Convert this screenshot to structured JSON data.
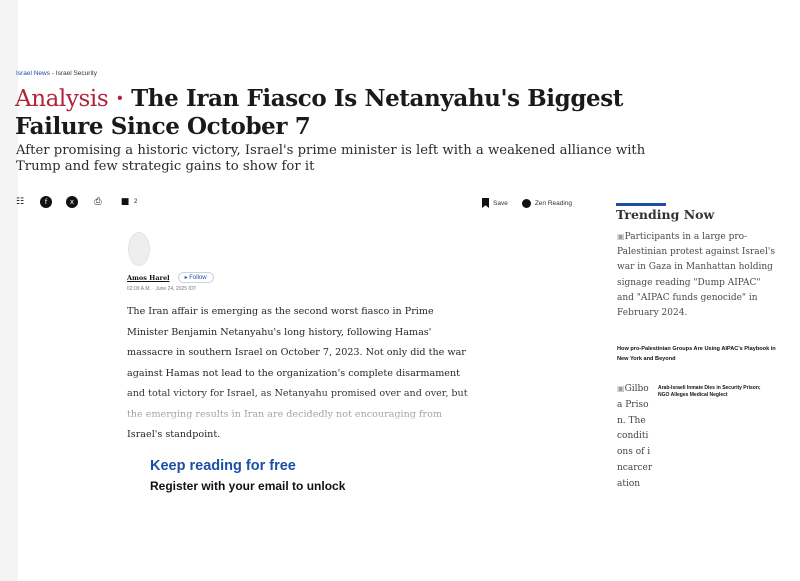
{
  "breadcrumb": {
    "section": "Israel News",
    "separator": "-",
    "subsection": "Israel Security"
  },
  "headline": {
    "label": "Analysis",
    "dot": "·",
    "title": "The Iran Fiasco Is Netanyahu's Biggest Failure Since October 7"
  },
  "subhead": "After promising a historic victory, Israel's prime minister is left with a weakened alliance with Trump and few strategic gains to show for it",
  "share": {
    "icons": [
      "gift-icon",
      "facebook-icon",
      "x-icon",
      "print-icon",
      "comment-icon"
    ],
    "comment_count": "2"
  },
  "tools": {
    "save_label": "Save",
    "zen_label": "Zen Reading"
  },
  "author": {
    "name": "Amos Harel",
    "follow_label": "Follow",
    "timestamp": "02:09 A.M. · June 24, 2025 IDT"
  },
  "article": {
    "body": "The Iran affair is emerging as the second worst fiasco in Prime Minister Benjamin Netanyahu's long history, following Hamas' massacre in southern Israel on October 7, 2023. Not only did the war against Hamas not lead to the organization's complete disarmament and total victory for Israel, as Netanyahu promised over and over, but the emerging results in Iran are decidedly not encouraging from Israel's standpoint."
  },
  "paywall": {
    "title": "Keep reading for free",
    "register_text": "Register with your email to unlock"
  },
  "sidebar": {
    "heading": "Trending Now",
    "item1_alt": "Participants in a large pro-Palestinian protest against Israel's war in Gaza in Manhattan holding signage reading \"Dump AIPAC\" and \"AIPAC funds genocide\" in February 2024.",
    "item1_title": "How pro-Palestinian Groups Are Using AIPAC's Playbook in New York and Beyond",
    "item2_alt": "Gilboa Prison. The conditions of incarceration",
    "item2_title": "Arab-Israeli Inmate Dies in Security Prison; NGO Alleges Medical Neglect"
  },
  "colors": {
    "accent": "#b2233a",
    "link": "#1b4fa8",
    "text": "#1a1a1a"
  }
}
